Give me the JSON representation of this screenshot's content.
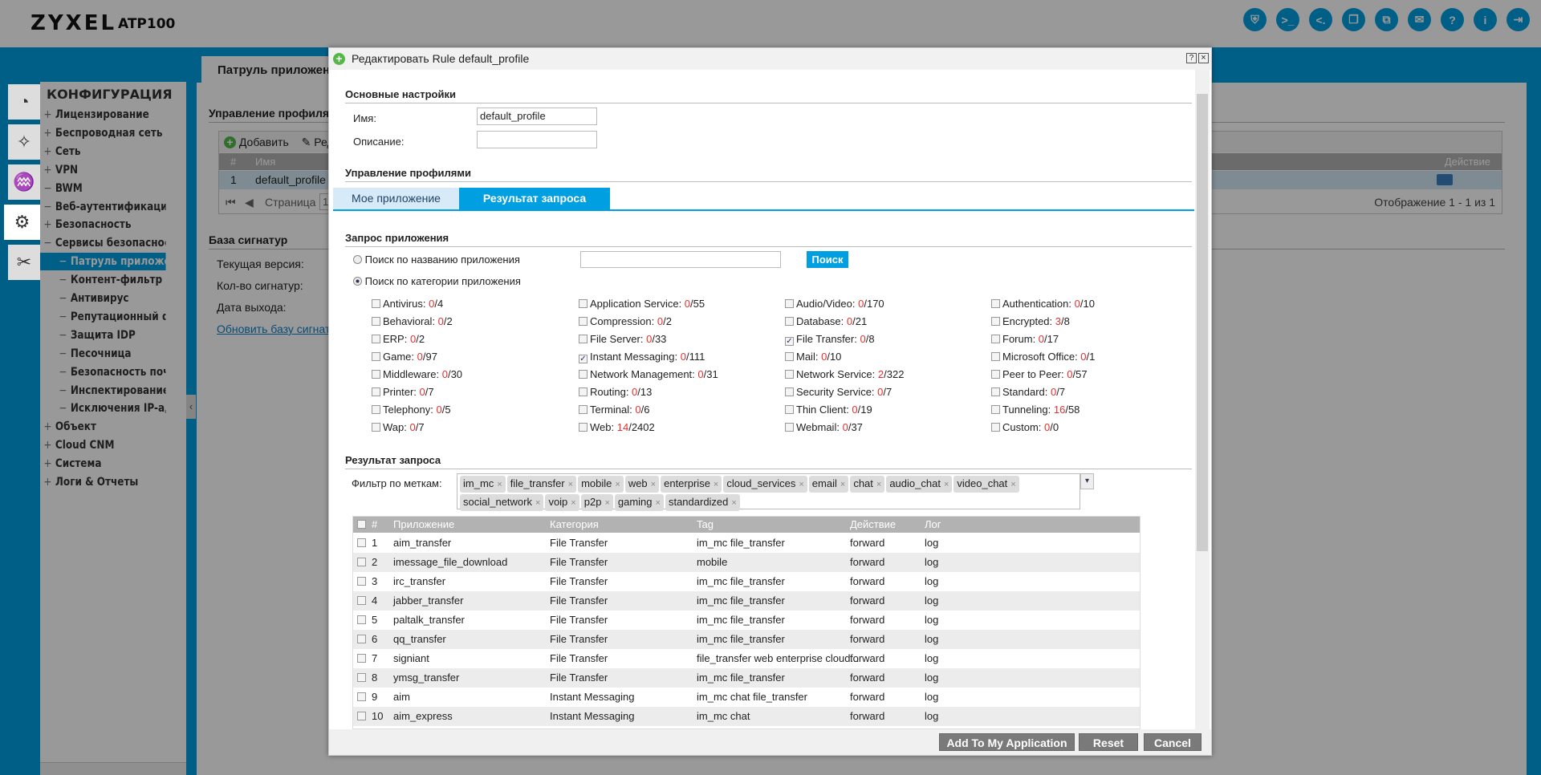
{
  "header": {
    "brand": "ZYXEL",
    "model": "ATP100",
    "icons": [
      "shield-icon",
      "console-icon",
      "cli-icon",
      "windows-icon",
      "network-icon",
      "chat-icon",
      "help-icon",
      "info-icon",
      "logout-icon"
    ]
  },
  "sidebar": {
    "tiles": [
      "dashboard-icon",
      "wizard-icon",
      "monitor-icon",
      "gear-icon",
      "maintenance-icon"
    ],
    "title": "КОНФИГУРАЦИЯ",
    "items": [
      {
        "p": "+",
        "label": "Лицензирование"
      },
      {
        "p": "+",
        "label": "Беспроводная сеть"
      },
      {
        "p": "+",
        "label": "Сеть"
      },
      {
        "p": "+",
        "label": "VPN"
      },
      {
        "p": "−",
        "label": "BWM"
      },
      {
        "p": "−",
        "label": "Веб-аутентификация"
      },
      {
        "p": "+",
        "label": "Безопасность"
      },
      {
        "p": "−",
        "label": "Сервисы безопасности"
      },
      {
        "p": "−",
        "label": "Патруль приложений",
        "sub": true,
        "sel": true
      },
      {
        "p": "−",
        "label": "Контент-фильтр",
        "sub": true
      },
      {
        "p": "−",
        "label": "Антивирус",
        "sub": true
      },
      {
        "p": "−",
        "label": "Репутационный фильтр",
        "sub": true
      },
      {
        "p": "−",
        "label": "Защита IDP",
        "sub": true
      },
      {
        "p": "−",
        "label": "Песочница",
        "sub": true
      },
      {
        "p": "−",
        "label": "Безопасность почты",
        "sub": true
      },
      {
        "p": "−",
        "label": "Инспектирование",
        "sub": true
      },
      {
        "p": "−",
        "label": "Исключения IP-адресов",
        "sub": true
      },
      {
        "p": "+",
        "label": "Объект"
      },
      {
        "p": "+",
        "label": "Cloud CNM"
      },
      {
        "p": "+",
        "label": "Система"
      },
      {
        "p": "+",
        "label": "Логи & Отчеты"
      }
    ]
  },
  "main": {
    "tab": "Патруль приложений",
    "profiles_title": "Управление профилями",
    "add": "Добавить",
    "edit": "Редактировать",
    "col_num": "#",
    "col_name": "Имя",
    "col_action": "Действие",
    "row_num": "1",
    "row_name": "default_profile",
    "page_label": "Страница",
    "page": "1",
    "display": "Отображение 1 - 1 из 1",
    "sig_title": "База сигнатур",
    "cur_version": "Текущая версия:",
    "sig_count": "Кол-во сигнатур:",
    "release_date": "Дата выхода:",
    "update_link": "Обновить базу сигнатур"
  },
  "modal": {
    "title": "Редактировать Rule default_profile",
    "basic": "Основные настройки",
    "name_label": "Имя:",
    "name_value": "default_profile",
    "desc_label": "Описание:",
    "desc_value": "",
    "profiles": "Управление профилями",
    "tabs": [
      "Мое приложение",
      "Результат запроса"
    ],
    "active_tab": 1,
    "query_title": "Запрос приложения",
    "radio_name": "Поиск по названию приложения",
    "radio_cat": "Поиск по категории приложения",
    "selected_radio": "category",
    "search_value": "",
    "search_btn": "Поиск",
    "categories": [
      {
        "n": "Antivirus",
        "s": "0",
        "t": "4"
      },
      {
        "n": "Application Service",
        "s": "0",
        "t": "55"
      },
      {
        "n": "Audio/Video",
        "s": "0",
        "t": "170"
      },
      {
        "n": "Authentication",
        "s": "0",
        "t": "10"
      },
      {
        "n": "Behavioral",
        "s": "0",
        "t": "2"
      },
      {
        "n": "Compression",
        "s": "0",
        "t": "2"
      },
      {
        "n": "Database",
        "s": "0",
        "t": "21"
      },
      {
        "n": "Encrypted",
        "s": "3",
        "t": "8"
      },
      {
        "n": "ERP",
        "s": "0",
        "t": "2"
      },
      {
        "n": "File Server",
        "s": "0",
        "t": "33"
      },
      {
        "n": "File Transfer",
        "s": "0",
        "t": "8",
        "c": true
      },
      {
        "n": "Forum",
        "s": "0",
        "t": "17"
      },
      {
        "n": "Game",
        "s": "0",
        "t": "97"
      },
      {
        "n": "Instant Messaging",
        "s": "0",
        "t": "111",
        "c": true
      },
      {
        "n": "Mail",
        "s": "0",
        "t": "10"
      },
      {
        "n": "Microsoft Office",
        "s": "0",
        "t": "1"
      },
      {
        "n": "Middleware",
        "s": "0",
        "t": "30"
      },
      {
        "n": "Network Management",
        "s": "0",
        "t": "31"
      },
      {
        "n": "Network Service",
        "s": "2",
        "t": "322"
      },
      {
        "n": "Peer to Peer",
        "s": "0",
        "t": "57"
      },
      {
        "n": "Printer",
        "s": "0",
        "t": "7"
      },
      {
        "n": "Routing",
        "s": "0",
        "t": "13"
      },
      {
        "n": "Security Service",
        "s": "0",
        "t": "7"
      },
      {
        "n": "Standard",
        "s": "0",
        "t": "7"
      },
      {
        "n": "Telephony",
        "s": "0",
        "t": "5"
      },
      {
        "n": "Terminal",
        "s": "0",
        "t": "6"
      },
      {
        "n": "Thin Client",
        "s": "0",
        "t": "19"
      },
      {
        "n": "Tunneling",
        "s": "16",
        "t": "58"
      },
      {
        "n": "Wap",
        "s": "0",
        "t": "7"
      },
      {
        "n": "Web",
        "s": "14",
        "t": "2402"
      },
      {
        "n": "Webmail",
        "s": "0",
        "t": "37"
      },
      {
        "n": "Custom",
        "s": "0",
        "t": "0"
      }
    ],
    "result_title": "Результат запроса",
    "filter_label": "Фильтр по меткам:",
    "tags": [
      "im_mc",
      "file_transfer",
      "mobile",
      "web",
      "enterprise",
      "cloud_services",
      "email",
      "chat",
      "audio_chat",
      "video_chat",
      "social_network",
      "voip",
      "p2p",
      "gaming",
      "standardized"
    ],
    "table": {
      "headers": [
        "#",
        "Приложение",
        "Категория",
        "Tag",
        "Действие",
        "Лог"
      ],
      "rows": [
        [
          "1",
          "aim_transfer",
          "File Transfer",
          "im_mc file_transfer",
          "forward",
          "log"
        ],
        [
          "2",
          "imessage_file_download",
          "File Transfer",
          "mobile",
          "forward",
          "log"
        ],
        [
          "3",
          "irc_transfer",
          "File Transfer",
          "im_mc file_transfer",
          "forward",
          "log"
        ],
        [
          "4",
          "jabber_transfer",
          "File Transfer",
          "im_mc file_transfer",
          "forward",
          "log"
        ],
        [
          "5",
          "paltalk_transfer",
          "File Transfer",
          "im_mc file_transfer",
          "forward",
          "log"
        ],
        [
          "6",
          "qq_transfer",
          "File Transfer",
          "im_mc file_transfer",
          "forward",
          "log"
        ],
        [
          "7",
          "signiant",
          "File Transfer",
          "file_transfer web enterprise cloud...",
          "forward",
          "log"
        ],
        [
          "8",
          "ymsg_transfer",
          "File Transfer",
          "im_mc file_transfer",
          "forward",
          "log"
        ],
        [
          "9",
          "aim",
          "Instant Messaging",
          "im_mc chat file_transfer",
          "forward",
          "log"
        ],
        [
          "10",
          "aim_express",
          "Instant Messaging",
          "im_mc chat",
          "forward",
          "log"
        ]
      ]
    },
    "buttons": {
      "add": "Add To My Application",
      "reset": "Reset",
      "cancel": "Cancel"
    }
  },
  "colors": {
    "accent": "#009fe1",
    "count_selected": "#e53030",
    "button": "#7a7a7a"
  }
}
